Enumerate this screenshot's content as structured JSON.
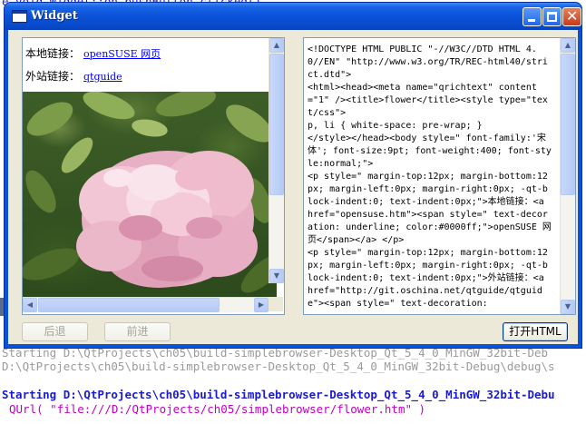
{
  "background": {
    "top_text": "e void Widget::on_pushButton_clicked()",
    "lines": [
      "Starting D:\\QtProjects\\ch05\\build-simplebrowser-Desktop_Qt_5_4_0_MinGW_32bit-Deb",
      "D:\\QtProjects\\ch05\\build-simplebrowser-Desktop_Qt_5_4_0_MinGW_32bit-Debug\\debug\\s",
      "Starting D:\\QtProjects\\ch05\\build-simplebrowser-Desktop_Qt_5_4_0_MinGW_32bit-Debu",
      "QUrl( \"file:///D:/QtProjects/ch05/simplebrowser/flower.htm\" )"
    ]
  },
  "window": {
    "title": "Widget",
    "close_glyph": "✕"
  },
  "browser": {
    "local_link_label": "本地链接：",
    "local_link_text": "openSUSE 网页",
    "site_link_label": "外站链接：",
    "site_link_text": "qtguide",
    "image_alt": "flower"
  },
  "source_view": {
    "text": "<!DOCTYPE HTML PUBLIC \"-//W3C//DTD HTML 4.0//EN\" \"http://www.w3.org/TR/REC-html40/strict.dtd\">\n<html><head><meta name=\"qrichtext\" content=\"1\" /><title>flower</title><style type=\"text/css\">\np, li { white-space: pre-wrap; }\n</style></head><body style=\" font-family:'宋体'; font-size:9pt; font-weight:400; font-style:normal;\">\n<p style=\" margin-top:12px; margin-bottom:12px; margin-left:0px; margin-right:0px; -qt-block-indent:0; text-indent:0px;\">本地链接：<a href=\"opensuse.htm\"><span style=\" text-decoration: underline; color:#0000ff;\">openSUSE 网页</span></a> </p>\n<p style=\" margin-top:12px; margin-bottom:12px; margin-left:0px; margin-right:0px; -qt-block-indent:0; text-indent:0px;\">外站链接：<a href=\"http://git.oschina.net/qtguide/qtguide\"><span style=\" text-decoration:"
  },
  "buttons": {
    "back": "后退",
    "forward": "前进",
    "open_html": "打开HTML"
  },
  "scroll": {
    "up_arrow": "▲",
    "down_arrow": "▼",
    "left_arrow": "◀",
    "right_arrow": "▶"
  },
  "colors": {
    "titlebar": "#0a52d8",
    "link": "#0000ff",
    "client_bg": "#ece9d8"
  }
}
